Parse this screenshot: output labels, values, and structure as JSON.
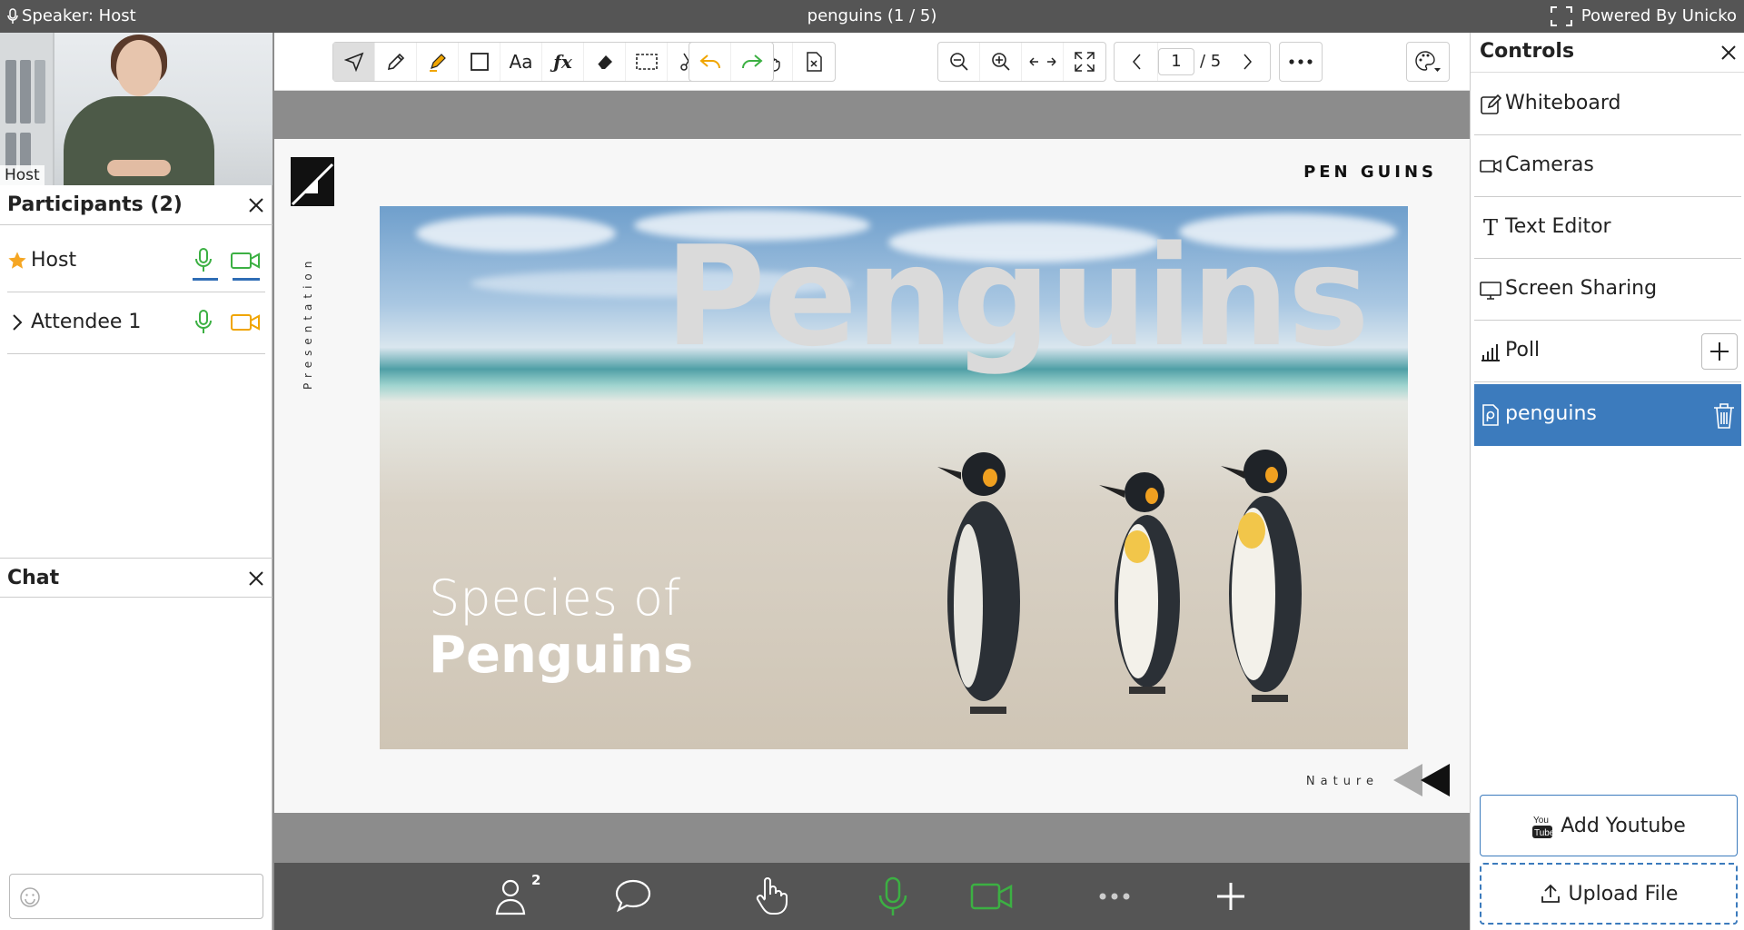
{
  "topbar": {
    "speaker": "Speaker: Host",
    "title": "penguins (1 / 5)",
    "powered": "Powered By Unicko"
  },
  "video": {
    "label": "Host"
  },
  "participants": {
    "title": "Participants (2)",
    "rows": [
      {
        "name": "Host",
        "lead_icon": "star-icon"
      },
      {
        "name": "Attendee 1",
        "lead_icon": "chevron-right-icon"
      }
    ]
  },
  "chat": {
    "title": "Chat"
  },
  "toolbar": {
    "page_current": "1",
    "page_total": "/ 5",
    "text_tool": "Aa"
  },
  "slide": {
    "brand": "PEN GUINS",
    "vertical_text": "Presentation",
    "big_title": "Penguins",
    "subtitle_line1": "Species of",
    "subtitle_line2": "Penguins",
    "footer": "Nature"
  },
  "bottombar": {
    "participants_count": "2"
  },
  "controls": {
    "title": "Controls",
    "items": [
      {
        "label": "Whiteboard",
        "icon": "edit-icon"
      },
      {
        "label": "Cameras",
        "icon": "camera-icon"
      },
      {
        "label": "Text Editor",
        "icon": "text-icon"
      },
      {
        "label": "Screen Sharing",
        "icon": "monitor-icon"
      },
      {
        "label": "Poll",
        "icon": "bar-chart-icon"
      },
      {
        "label": "penguins",
        "icon": "file-icon"
      }
    ],
    "add_youtube": "Add Youtube",
    "upload_file": "Upload File"
  },
  "colors": {
    "accent": "#3c7bbd",
    "green": "#3cb043",
    "orange": "#f0a500",
    "bar": "#555555"
  }
}
